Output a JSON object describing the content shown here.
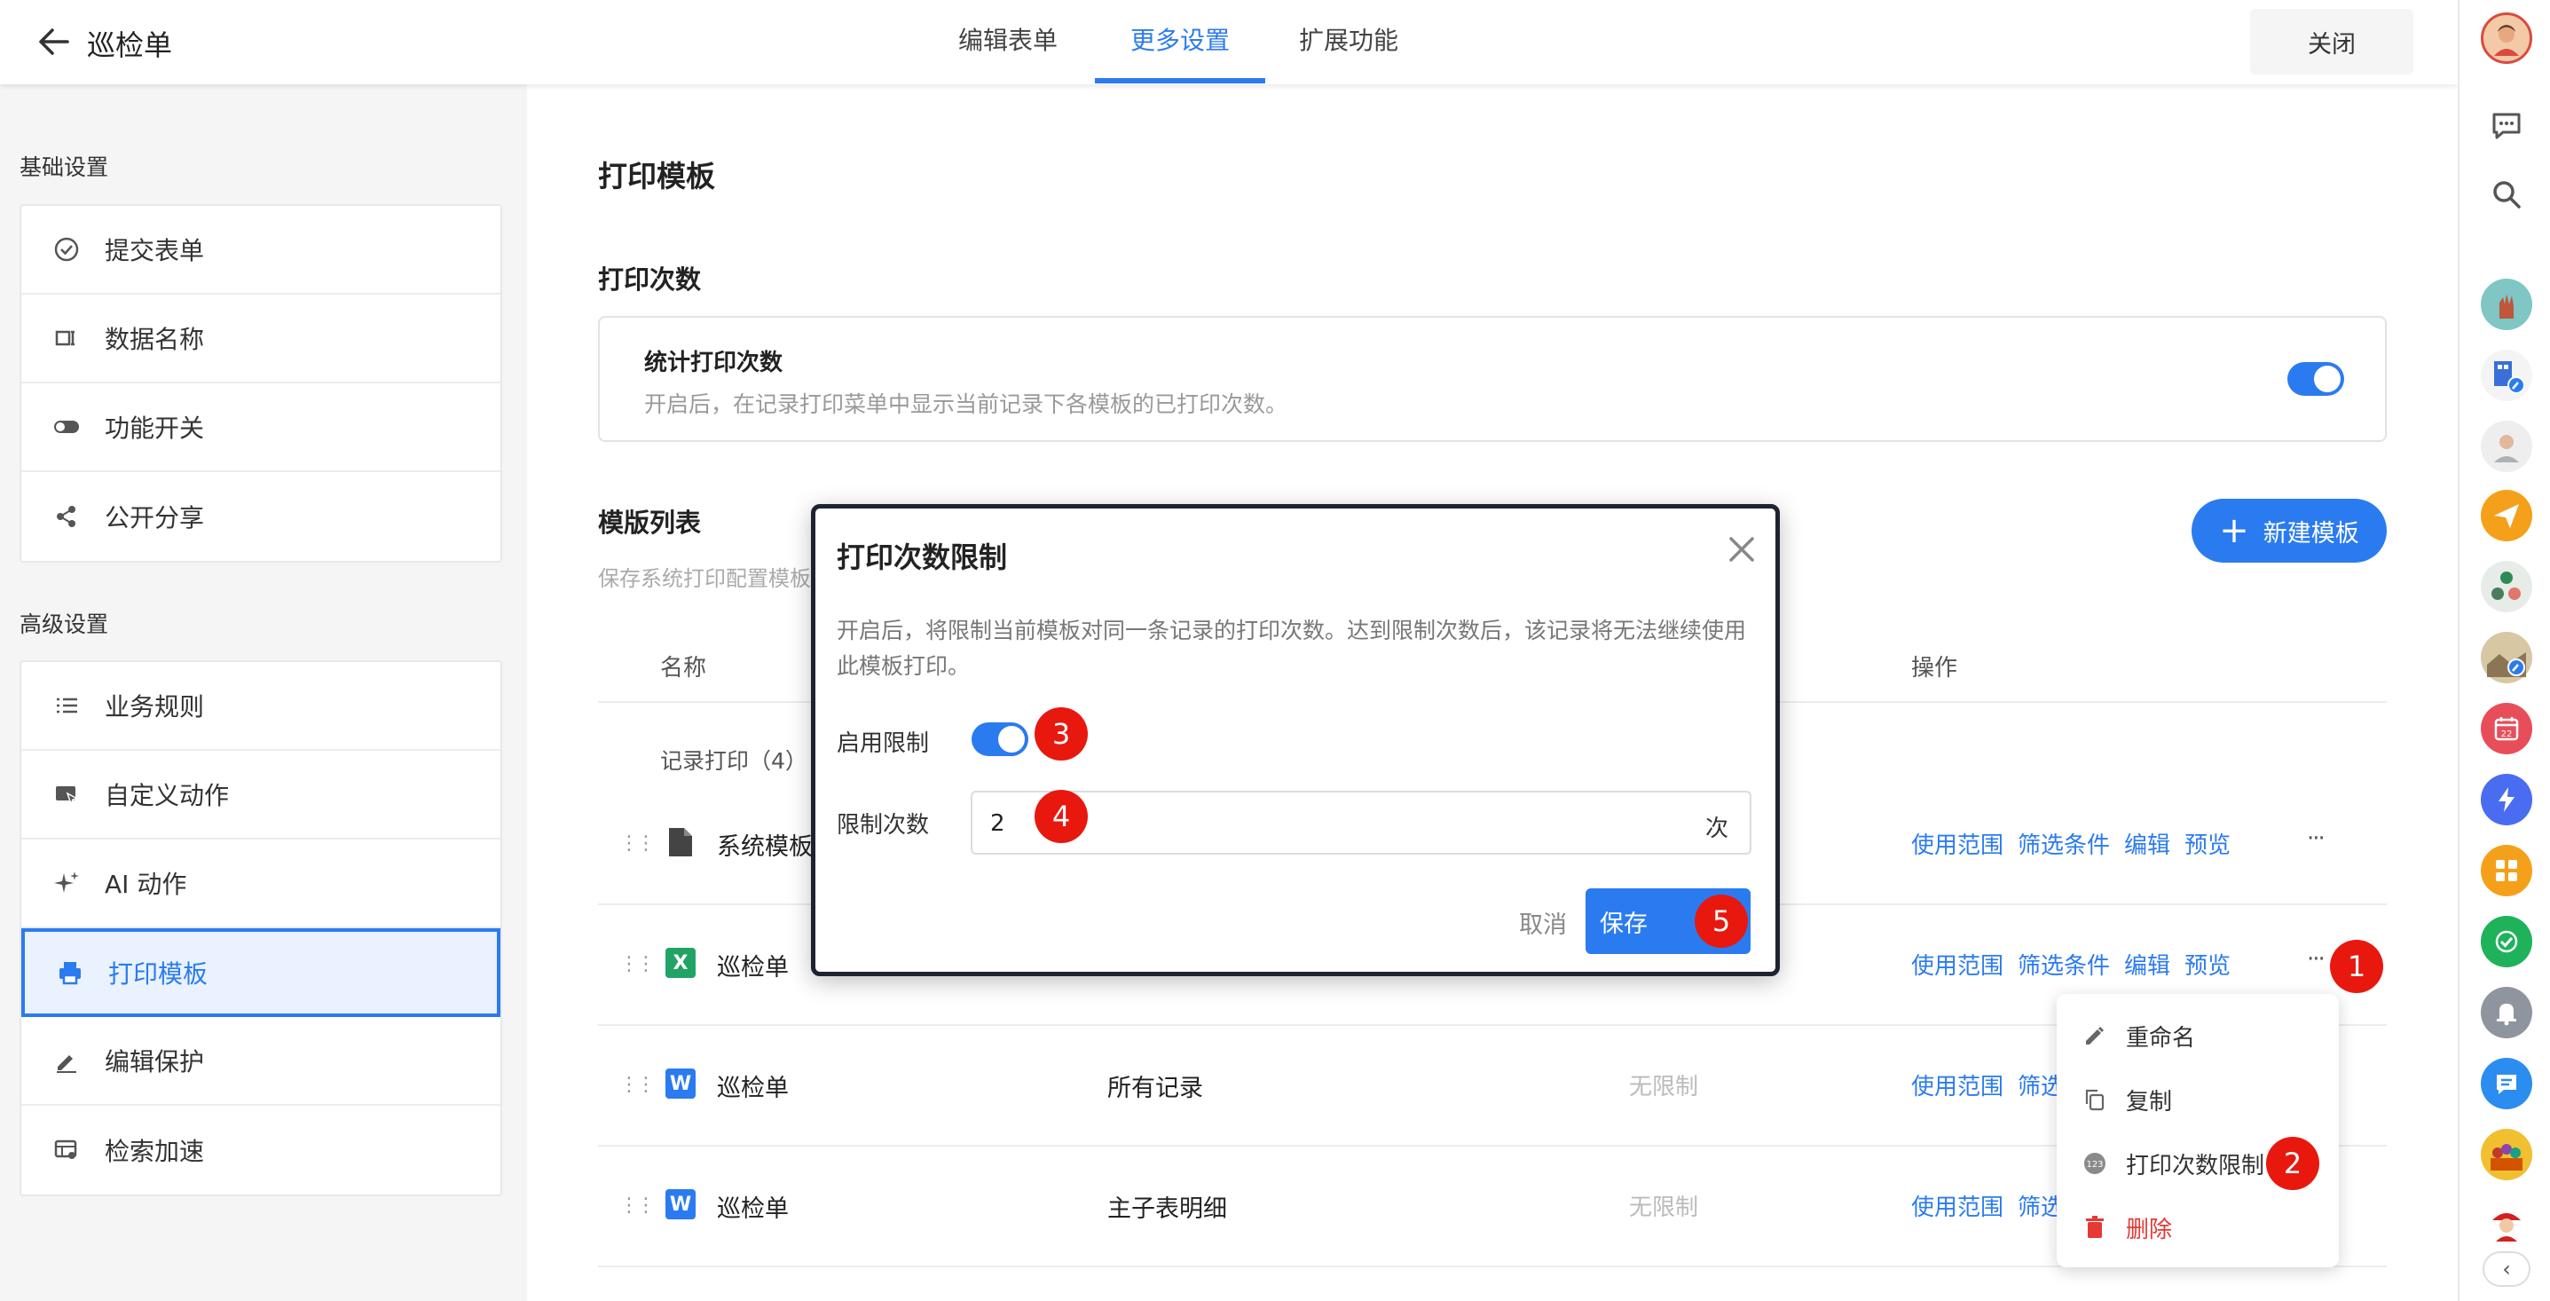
{
  "app": {
    "title": "巡检单",
    "close_label": "关闭"
  },
  "tabs": [
    {
      "label": "编辑表单"
    },
    {
      "label": "更多设置"
    },
    {
      "label": "扩展功能"
    }
  ],
  "sidebar": {
    "basic_title": "基础设置",
    "basic_items": [
      {
        "label": "提交表单",
        "icon": "check-circle-icon"
      },
      {
        "label": "数据名称",
        "icon": "name-tag-icon"
      },
      {
        "label": "功能开关",
        "icon": "toggle-icon"
      },
      {
        "label": "公开分享",
        "icon": "share-icon"
      }
    ],
    "advanced_title": "高级设置",
    "advanced_items": [
      {
        "label": "业务规则",
        "icon": "list-icon"
      },
      {
        "label": "自定义动作",
        "icon": "custom-action-icon"
      },
      {
        "label": "AI 动作",
        "icon": "sparkle-icon"
      },
      {
        "label": "打印模板",
        "icon": "printer-icon",
        "active": true
      },
      {
        "label": "编辑保护",
        "icon": "edit-lock-icon"
      },
      {
        "label": "检索加速",
        "icon": "search-accel-icon"
      }
    ]
  },
  "main": {
    "title": "打印模板",
    "print_count": {
      "heading": "打印次数",
      "card_title": "统计打印次数",
      "card_desc": "开启后，在记录打印菜单中显示当前记录下各模板的已打印次数。",
      "enabled": true
    },
    "templates": {
      "heading": "模版列表",
      "desc": "保存系统打印配置模板",
      "new_button": "新建模板",
      "columns": {
        "name": "名称",
        "ops": "操作"
      },
      "group_label": "记录打印（4）",
      "rows": [
        {
          "icon": "document-icon",
          "name": "系统模板",
          "scope": "",
          "limit": "",
          "ops": [
            "使用范围",
            "筛选条件",
            "编辑",
            "预览"
          ]
        },
        {
          "icon": "excel-icon",
          "icon_text": "X",
          "name": "巡检单",
          "scope": "",
          "limit": "",
          "ops": [
            "使用范围",
            "筛选条件",
            "编辑",
            "预览"
          ]
        },
        {
          "icon": "word-icon",
          "icon_text": "W",
          "name": "巡检单",
          "scope": "所有记录",
          "limit": "无限制",
          "ops": [
            "使用范围",
            "筛选"
          ]
        },
        {
          "icon": "word-icon",
          "icon_text": "W",
          "name": "巡检单",
          "scope": "主子表明细",
          "limit": "无限制",
          "ops": [
            "使用范围",
            "筛选"
          ]
        }
      ],
      "more": "···"
    }
  },
  "dropdown": {
    "items": [
      {
        "label": "重命名",
        "icon": "pencil-icon"
      },
      {
        "label": "复制",
        "icon": "copy-icon"
      },
      {
        "label": "打印次数限制",
        "icon": "counter-icon"
      },
      {
        "label": "删除",
        "icon": "trash-icon",
        "danger": true
      }
    ]
  },
  "modal": {
    "title": "打印次数限制",
    "desc": "开启后，将限制当前模板对同一条记录的打印次数。达到限制次数后，该记录将无法继续使用此模板打印。",
    "enable_label": "启用限制",
    "enabled": true,
    "limit_label": "限制次数",
    "limit_value": "2",
    "limit_unit": "次",
    "cancel": "取消",
    "save": "保存"
  },
  "badges": [
    "1",
    "2",
    "3",
    "4",
    "5"
  ],
  "colors": {
    "accent": "#2b7bf0",
    "badge": "#e8180f",
    "danger": "#e53935"
  }
}
